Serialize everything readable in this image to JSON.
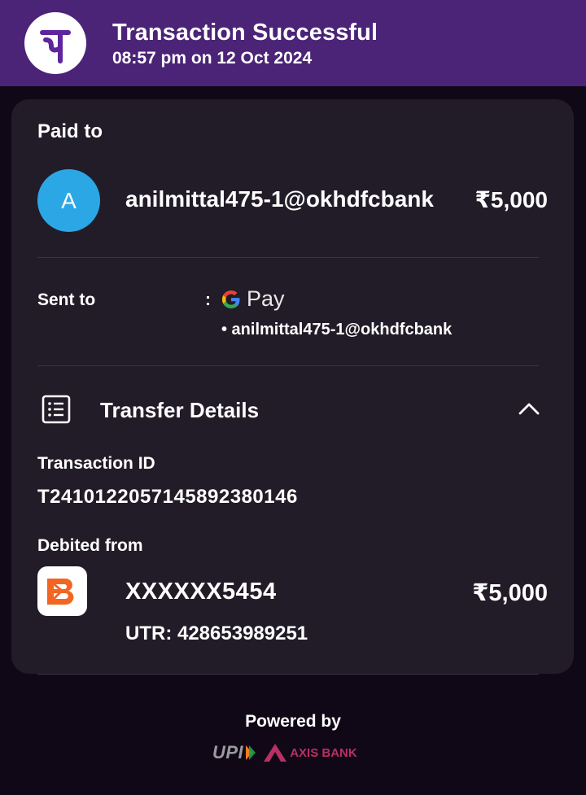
{
  "header": {
    "title": "Transaction Successful",
    "subtitle": "08:57 pm on 12 Oct 2024",
    "logo_glyph": "पे",
    "brand_color": "#4b2377"
  },
  "paid_to": {
    "label": "Paid to",
    "avatar_letter": "A",
    "avatar_color": "#2ba7e6",
    "payee": "anilmittal475-1@okhdfcbank",
    "amount": "₹5,000"
  },
  "sent_to": {
    "label": "Sent to",
    "colon": ":",
    "app_name": "Pay",
    "vpa": "• anilmittal475-1@okhdfcbank"
  },
  "transfer_details": {
    "title": "Transfer Details",
    "transaction_id_label": "Transaction ID",
    "transaction_id": "T2410122057145892380146",
    "debited_label": "Debited from",
    "account": "XXXXXX5454",
    "amount": "₹5,000",
    "utr": "UTR: 428653989251"
  },
  "footer": {
    "powered_by": "Powered by",
    "upi": "UPI",
    "bank": "AXIS BANK"
  }
}
